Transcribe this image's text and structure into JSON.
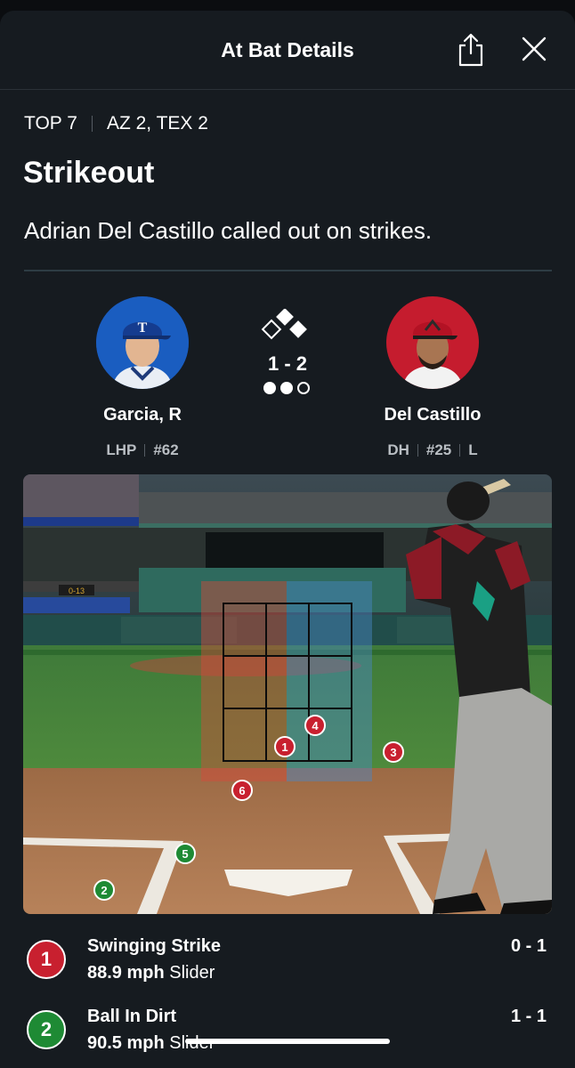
{
  "header": {
    "title": "At Bat Details"
  },
  "game": {
    "inning": "TOP 7",
    "score": "AZ 2, TEX 2"
  },
  "play": {
    "result": "Strikeout",
    "description": "Adrian Del Castillo called out on strikes."
  },
  "pitcher": {
    "name": "Garcia, R",
    "meta": [
      "LHP",
      "#62"
    ],
    "team_color": "#003278"
  },
  "batter": {
    "name": "Del Castillo",
    "meta": [
      "DH",
      "#25",
      "L"
    ],
    "team_color": "#a71930"
  },
  "count": {
    "value": "1 - 2",
    "outs": 2,
    "outs_total": 3
  },
  "pitches": [
    {
      "number": "1",
      "type": "Swinging Strike",
      "speed": "88.9 mph",
      "pitch": "Slider",
      "count": "0 - 1",
      "color": "#c8202f"
    },
    {
      "number": "2",
      "type": "Ball In Dirt",
      "speed": "90.5 mph",
      "pitch": "Slider",
      "count": "1 - 1",
      "color": "#1e8a34"
    }
  ],
  "pitch_markers": [
    {
      "n": "1",
      "kind": "strike"
    },
    {
      "n": "2",
      "kind": "ball"
    },
    {
      "n": "3",
      "kind": "strike"
    },
    {
      "n": "4",
      "kind": "strike"
    },
    {
      "n": "5",
      "kind": "ball"
    },
    {
      "n": "6",
      "kind": "strike"
    }
  ],
  "icons": {
    "share": "share-icon",
    "close": "close-icon",
    "bases": "bases-icon"
  }
}
